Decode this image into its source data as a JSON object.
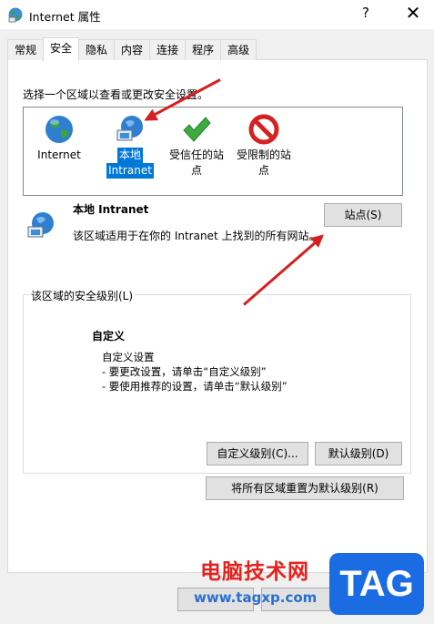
{
  "window": {
    "title": "Internet 属性",
    "help": "?",
    "close": "✕"
  },
  "tabs": [
    "常规",
    "安全",
    "隐私",
    "内容",
    "连接",
    "程序",
    "高级"
  ],
  "active_tab": "安全",
  "security": {
    "instruction": "选择一个区域以查看或更改安全设置。",
    "zones": [
      {
        "line1": "Internet",
        "line2": "",
        "icon": "globe-icon"
      },
      {
        "line1": "本地",
        "line2": "Intranet",
        "icon": "intranet-icon",
        "selected": true
      },
      {
        "line1": "受信任的站",
        "line2": "点",
        "icon": "checkmark-icon"
      },
      {
        "line1": "受限制的站",
        "line2": "点",
        "icon": "restricted-icon"
      }
    ],
    "selected_zone": {
      "title": "本地 Intranet",
      "description": "该区域适用于在你的 Intranet 上找到的所有网站。",
      "sites_button": "站点(S)"
    },
    "level_group": {
      "label": "该区域的安全级别(L)",
      "level_name": "自定义",
      "lines": [
        "自定义设置",
        "- 要更改设置，请单击“自定义级别”",
        "- 要使用推荐的设置，请单击“默认级别”"
      ],
      "custom_level_button": "自定义级别(C)...",
      "default_level_button": "默认级别(D)"
    },
    "reset_all_button": "将所有区域重置为默认级别(R)"
  },
  "watermark": {
    "site_name": "电脑技术网",
    "url": "www.tagxp.com",
    "tag": "TAG"
  },
  "colors": {
    "selection": "#0078d7",
    "arrow": "#d62020",
    "watermark_red": "#e8201c",
    "watermark_blue": "#1b6be3"
  }
}
